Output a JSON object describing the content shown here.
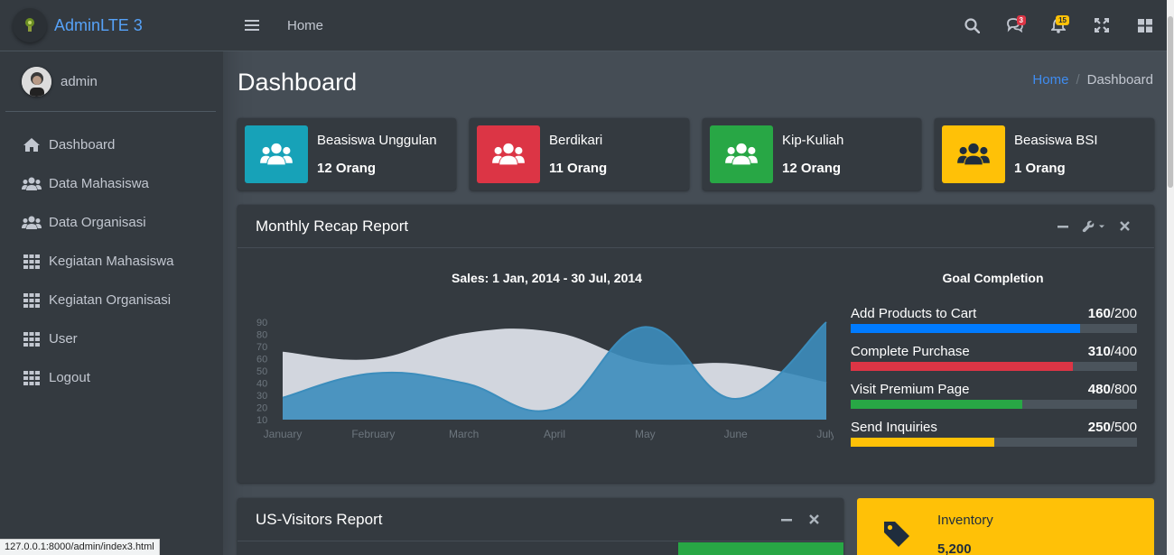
{
  "brand": {
    "name": "AdminLTE 3"
  },
  "user": {
    "name": "admin"
  },
  "sidebar": {
    "items": [
      {
        "label": "Dashboard",
        "icon": "home-icon"
      },
      {
        "label": "Data Mahasiswa",
        "icon": "users-icon"
      },
      {
        "label": "Data Organisasi",
        "icon": "users-icon"
      },
      {
        "label": "Kegiatan Mahasiswa",
        "icon": "grid-icon"
      },
      {
        "label": "Kegiatan Organisasi",
        "icon": "grid-icon"
      },
      {
        "label": "User",
        "icon": "grid-icon"
      },
      {
        "label": "Logout",
        "icon": "grid-icon"
      }
    ]
  },
  "topbar": {
    "home": "Home",
    "messages_badge": "3",
    "notifications_badge": "15"
  },
  "page": {
    "title": "Dashboard",
    "breadcrumb": {
      "home": "Home",
      "sep": "/",
      "current": "Dashboard"
    }
  },
  "info_boxes": [
    {
      "label": "Beasiswa Unggulan",
      "value": "12 Orang",
      "color": "#17a2b8"
    },
    {
      "label": "Berdikari",
      "value": "11 Orang",
      "color": "#dc3545"
    },
    {
      "label": "Kip-Kuliah",
      "value": "12 Orang",
      "color": "#28a745"
    },
    {
      "label": "Beasiswa BSI",
      "value": "1 Orang",
      "color": "#ffc107"
    }
  ],
  "monthly": {
    "title": "Monthly Recap Report",
    "chart_title": "Sales: 1 Jan, 2014 - 30 Jul, 2014",
    "goal_title": "Goal Completion",
    "goals": [
      {
        "label": "Add Products to Cart",
        "value": "160",
        "total": "/200",
        "fraction": 0.8,
        "color": "#007bff"
      },
      {
        "label": "Complete Purchase",
        "value": "310",
        "total": "/400",
        "fraction": 0.775,
        "color": "#dc3545"
      },
      {
        "label": "Visit Premium Page",
        "value": "480",
        "total": "/800",
        "fraction": 0.6,
        "color": "#28a745"
      },
      {
        "label": "Send Inquiries",
        "value": "250",
        "total": "/500",
        "fraction": 0.5,
        "color": "#ffc107"
      }
    ]
  },
  "visitors": {
    "title": "US-Visitors Report"
  },
  "inventory": {
    "label": "Inventory",
    "value": "5,200"
  },
  "status_url": "127.0.0.1:8000/admin/index3.html",
  "chart_data": {
    "type": "area",
    "title": "Sales: 1 Jan, 2014 - 30 Jul, 2014",
    "categories": [
      "January",
      "February",
      "March",
      "April",
      "May",
      "June",
      "July"
    ],
    "y_ticks": [
      10,
      20,
      30,
      40,
      50,
      60,
      70,
      80,
      90
    ],
    "ylim": [
      10,
      90
    ],
    "grid": false,
    "series": [
      {
        "values": [
          65,
          59,
          80,
          81,
          56,
          55,
          40
        ],
        "color": "#d2d6de"
      },
      {
        "values": [
          28,
          48,
          40,
          19,
          86,
          27,
          90
        ],
        "color": "#3c8dbc"
      }
    ]
  }
}
